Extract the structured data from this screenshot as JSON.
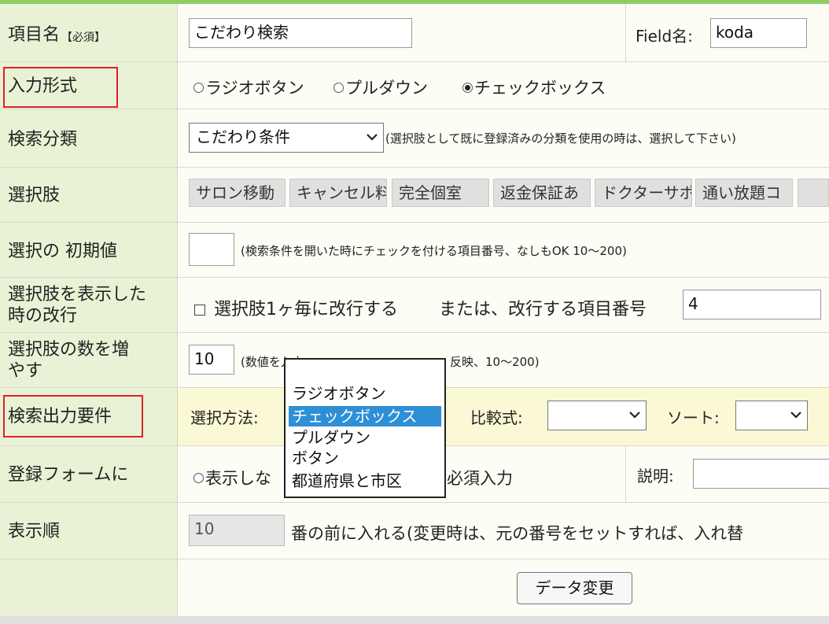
{
  "labels": {
    "item_name": "項目名",
    "required": "【必須】",
    "input_type": "入力形式",
    "search_category": "検索分類",
    "choices": "選択肢",
    "initial_value": "選択の 初期値",
    "linebreak_1": "選択肢を表示した",
    "linebreak_2": "時の改行",
    "increase_1": "選択肢の数を増",
    "increase_2": "やす",
    "output_req": "検索出力要件",
    "register_form": "登録フォームに",
    "display_order": "表示順"
  },
  "row1": {
    "item_name_value": "こだわり検索",
    "field_label": "Field名:",
    "field_value": "koda"
  },
  "row2": {
    "options": [
      "ラジオボタン",
      "プルダウン",
      "チェックボックス"
    ],
    "selected": "チェックボックス"
  },
  "row3": {
    "select_value": "こだわり条件",
    "note": "(選択肢として既に登録済みの分類を使用の時は、選択して下さい)"
  },
  "row4": {
    "tags": [
      "サロン移動",
      "キャンセル料",
      "完全個室",
      "返金保証あ",
      "ドクターサポ",
      "通い放題コ",
      ""
    ]
  },
  "row5": {
    "value": "",
    "note": "(検索条件を開いた時にチェックを付ける項目番号、なしもOK 10～200)"
  },
  "row6": {
    "checkbox_label": "選択肢1ヶ毎に改行する",
    "or_text": "または、改行する項目番号",
    "number_value": "4"
  },
  "row7": {
    "value": "10",
    "note_left": "(数値を入力",
    "note_right": "反映、10～200)"
  },
  "row8": {
    "method_label": "選択方法:",
    "compare_label": "比較式:",
    "sort_label": "ソート:"
  },
  "row9": {
    "radio_text": "表示しな",
    "required_text": "必須入力",
    "desc_label": "説明:"
  },
  "row10": {
    "value": "10",
    "text": "番の前に入れる(変更時は、元の番号をセットすれば、入れ替"
  },
  "dropdown": {
    "options": [
      "ラジオボタン",
      "チェックボックス",
      "プルダウン",
      "ボタン",
      "都道府県と市区"
    ],
    "highlighted": 1
  },
  "footer": {
    "button": "データ変更"
  },
  "colors": {
    "label_bg": "#e9f2d5",
    "highlight": "#2e8fd6",
    "red": "#e0202a",
    "top_bar": "#8fcc66"
  }
}
